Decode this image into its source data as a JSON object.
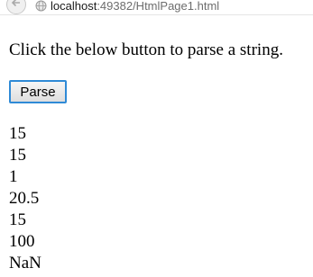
{
  "browser": {
    "url_host": "localhost",
    "url_path": ":49382/HtmlPage1.html"
  },
  "page": {
    "instruction": "Click the below button to parse a string.",
    "parse_button_label": "Parse",
    "results": [
      "15",
      "15",
      "1",
      "20.5",
      "15",
      "100",
      "NaN"
    ]
  }
}
